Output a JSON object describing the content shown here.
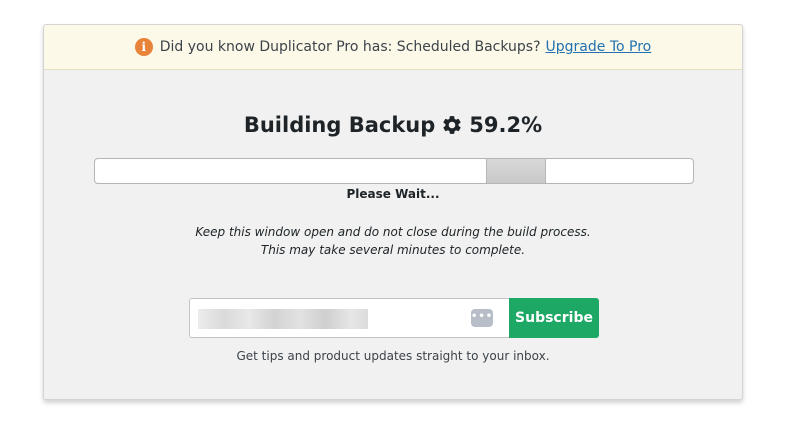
{
  "notice": {
    "icon": "info-icon",
    "icon_glyph": "i",
    "text": "Did you know Duplicator Pro has: Scheduled Backups?",
    "link_label": "Upgrade To Pro"
  },
  "build": {
    "title": "Building Backup",
    "gear_icon": "gear-icon",
    "percent_label": "59.2%",
    "progress_fraction": 0.592,
    "status": "Please Wait...",
    "keep_open_line1": "Keep this window open and do not close during the build process.",
    "keep_open_line2": "This may take several minutes to complete."
  },
  "subscribe": {
    "dots_icon": "more-dots-icon",
    "dots_glyph": "•••",
    "button_label": "Subscribe",
    "tips": "Get tips and product updates straight to your inbox."
  },
  "colors": {
    "notice_bg": "#fcf9e8",
    "info_icon": "#e8833a",
    "link": "#2271b1",
    "subscribe_button": "#1ea866"
  }
}
